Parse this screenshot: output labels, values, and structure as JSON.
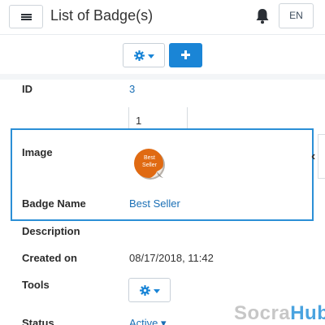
{
  "header": {
    "title": "List of Badge(s)",
    "language": "EN"
  },
  "icons": {
    "menu": "hamburger-icon",
    "notifications": "bell-icon",
    "settings": "gear-icon",
    "add": "plus-icon",
    "collapse": "chevron-left-icon"
  },
  "colors": {
    "accent": "#1a85d6",
    "link": "#1a6fb5",
    "focus_border": "#2b8fd6",
    "badge": "#e06a12"
  },
  "fields": {
    "id": {
      "label": "ID",
      "value": "3"
    },
    "order": {
      "value": "1"
    },
    "image": {
      "label": "Image",
      "badge_text": "Best Seller"
    },
    "badge_name": {
      "label": "Badge Name",
      "value": "Best Seller"
    },
    "description": {
      "label": "Description",
      "value": ""
    },
    "created_on": {
      "label": "Created on",
      "value": "08/17/2018, 11:42"
    },
    "tools": {
      "label": "Tools"
    },
    "status": {
      "label": "Status",
      "value": "Active"
    }
  },
  "watermark": {
    "part1": "Socra",
    "part2": "Hub"
  }
}
